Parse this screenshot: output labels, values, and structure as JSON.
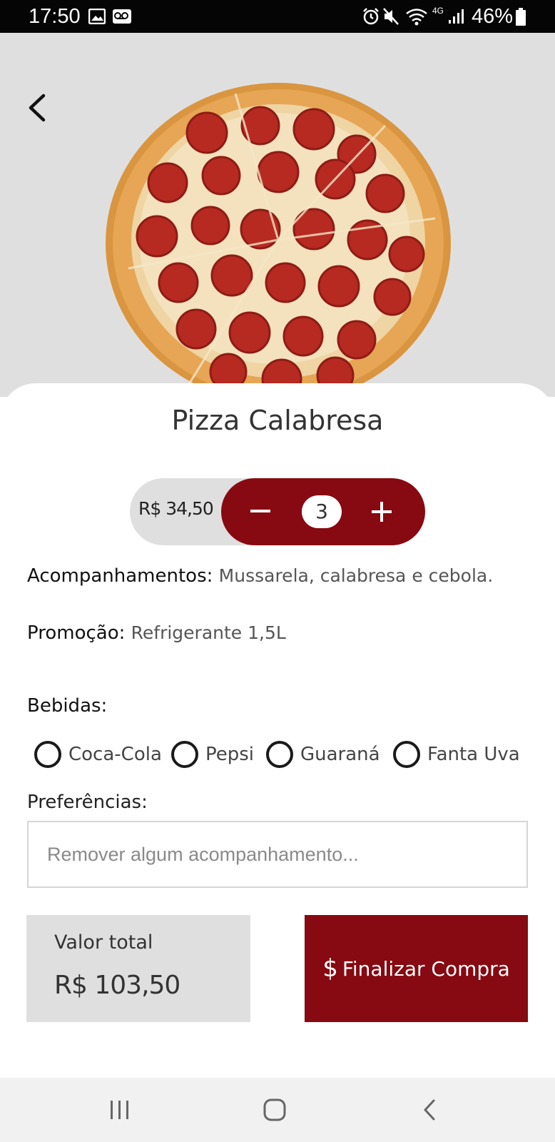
{
  "status_bar": {
    "time": "17:50",
    "battery": "46%",
    "network": "4G",
    "icons": [
      "image-icon",
      "voicemail-icon",
      "alarm-icon",
      "mute-icon",
      "wifi-icon",
      "signal-icon",
      "battery-icon"
    ]
  },
  "hero": {
    "back_icon": "chevron-left-icon",
    "image": "pepperoni-pizza-photo"
  },
  "product": {
    "title": "Pizza Calabresa",
    "price": "R$ 34,50",
    "quantity": "3",
    "minus_icon": "minus-icon",
    "plus_icon": "plus-icon"
  },
  "details": {
    "acompanhamentos_label": "Acompanhamentos:",
    "acompanhamentos_value": "Mussarela, calabresa e cebola.",
    "promocao_label": "Promoção:",
    "promocao_value": "Refrigerante 1,5L"
  },
  "drinks": {
    "label": "Bebidas:",
    "options": [
      "Coca-Cola",
      "Pepsi",
      "Guaraná",
      "Fanta Uva"
    ]
  },
  "preferences": {
    "label": "Preferências:",
    "placeholder": "Remover algum acompanhamento...",
    "value": ""
  },
  "total": {
    "label": "Valor total",
    "value": "R$ 103,50"
  },
  "checkout": {
    "icon": "$",
    "label": "Finalizar Compra"
  },
  "colors": {
    "accent": "#870911",
    "hero_bg": "#e0dfe0",
    "pill_bg": "#dfdfdf",
    "nav_bg": "#f1f1f1"
  },
  "nav_bar": {
    "icons": [
      "recent-apps-icon",
      "home-icon",
      "back-icon"
    ]
  }
}
